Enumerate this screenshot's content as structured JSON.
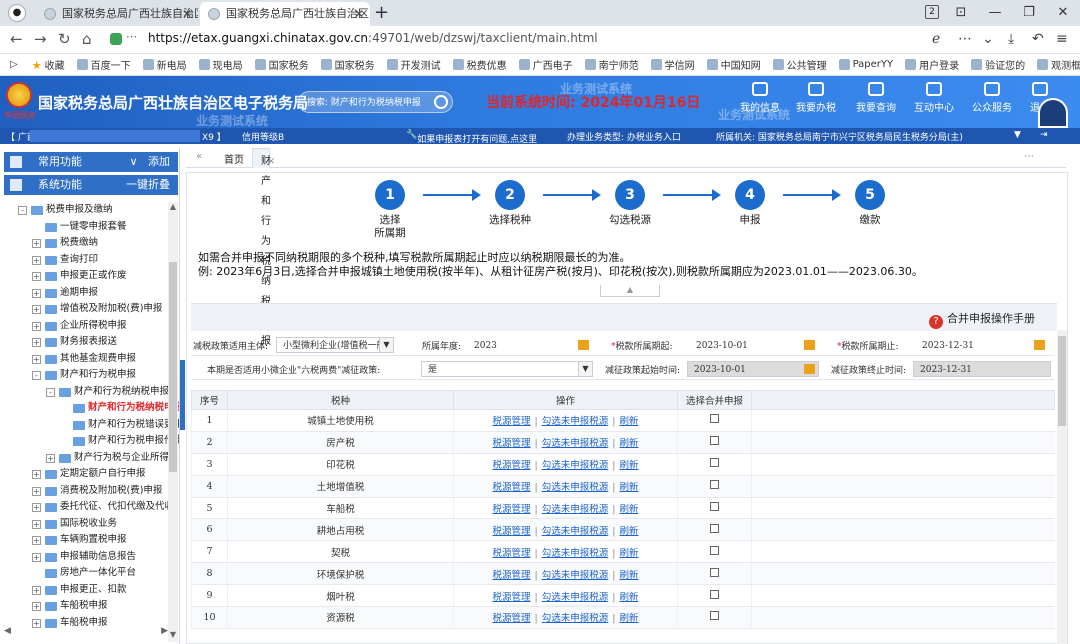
{
  "browser": {
    "tabs": [
      {
        "title": "国家税务总局广西壮族自治区",
        "active": false
      },
      {
        "title": "国家税务总局广西壮族自治区",
        "active": true
      }
    ],
    "tab_count": "2",
    "url_host": "https://etax.guangxi.chinatax.gov.cn",
    "url_path": ":49701/web/dzswj/taxclient/main.html",
    "bookmarks": [
      "收藏",
      "百度一下",
      "新电局",
      "现电局",
      "国家税务",
      "国家税务",
      "开发测试",
      "税费优惠",
      "广西电子",
      "南宁师范",
      "学信网",
      "中国知网",
      "公共管理",
      "PaperYY",
      "用户登录",
      "验证您的",
      "观测框"
    ]
  },
  "header": {
    "emblem_text": "中国税务",
    "site_title": "国家税务总局广西壮族自治区电子税务局",
    "watermark": "业务测试系统",
    "search_placeholder": "搜索: 财产和行为税纳税申报",
    "system_time_label": "当前系统时间: 2024年01月16日",
    "menu": [
      "我的信息",
      "我要办税",
      "我要查询",
      "互动中心",
      "公众服务",
      "退出"
    ],
    "accent": "#2f7be0",
    "date_color": "#e0262b"
  },
  "infobar": {
    "taxpayer_prefix": "【 广西",
    "taxpayer_suffix": "X9 】",
    "credit_level": "信用等级B",
    "refresh_hint": "如果申报表打开有问题,点这里",
    "business_type": "办理业务类型:  办税业务入口",
    "authority": "所属机关:  国家税务总局南宁市兴宁区税务局民生税务分局(主)"
  },
  "sidebar": {
    "common_label": "常用功能",
    "common_action": "添加",
    "system_label": "系统功能",
    "system_action": "一键折叠",
    "tree": [
      {
        "label": "税费申报及缴纳",
        "level": 0,
        "toggle": "-"
      },
      {
        "label": "一键零申报套餐",
        "level": 1,
        "toggle": ""
      },
      {
        "label": "税费缴纳",
        "level": 1,
        "toggle": "+"
      },
      {
        "label": "查询打印",
        "level": 1,
        "toggle": "+"
      },
      {
        "label": "申报更正或作废",
        "level": 1,
        "toggle": "+"
      },
      {
        "label": "逾期申报",
        "level": 1,
        "toggle": "+"
      },
      {
        "label": "增值税及附加税(费)申报",
        "level": 1,
        "toggle": "+"
      },
      {
        "label": "企业所得税申报",
        "level": 1,
        "toggle": "+"
      },
      {
        "label": "财务报表报送",
        "level": 1,
        "toggle": "+"
      },
      {
        "label": "其他基金规费申报",
        "level": 1,
        "toggle": "+"
      },
      {
        "label": "财产和行为税申报",
        "level": 1,
        "toggle": "-"
      },
      {
        "label": "财产和行为税纳税申报",
        "level": 2,
        "toggle": "-"
      },
      {
        "label": "财产和行为税纳税申报",
        "level": 3,
        "toggle": "",
        "selected": true
      },
      {
        "label": "财产和行为税错误更正",
        "level": 3,
        "toggle": ""
      },
      {
        "label": "财产和行为税申报作废",
        "level": 3,
        "toggle": ""
      },
      {
        "label": "财产行为税与企业所得税",
        "level": 2,
        "toggle": "+"
      },
      {
        "label": "定期定额户自行申报",
        "level": 1,
        "toggle": "+"
      },
      {
        "label": "消费税及附加税(费)申报",
        "level": 1,
        "toggle": "+"
      },
      {
        "label": "委托代征、代扣代缴及代收",
        "level": 1,
        "toggle": "+"
      },
      {
        "label": "国际税收业务",
        "level": 1,
        "toggle": "+"
      },
      {
        "label": "车辆购置税申报",
        "level": 1,
        "toggle": "+"
      },
      {
        "label": "申报辅助信息报告",
        "level": 1,
        "toggle": "+"
      },
      {
        "label": "房地产一体化平台",
        "level": 1,
        "toggle": ""
      },
      {
        "label": "申报更正、扣款",
        "level": 1,
        "toggle": "+"
      },
      {
        "label": "车船税申报",
        "level": 1,
        "toggle": "+"
      },
      {
        "label": "车船税申报",
        "level": 1,
        "toggle": "+"
      }
    ]
  },
  "main": {
    "tabs": {
      "home": "首页",
      "current": "财产和行为税纳税申报"
    },
    "steps": [
      {
        "num": "1",
        "label": "选择\n所属期"
      },
      {
        "num": "2",
        "label": "选择税种"
      },
      {
        "num": "3",
        "label": "勾选税源"
      },
      {
        "num": "4",
        "label": "申报"
      },
      {
        "num": "5",
        "label": "缴款"
      }
    ],
    "note1": "如需合并申报不同纳税期限的多个税种,填写税款所属期起止时应以纳税期限最长的为准。",
    "note2": "例: 2023年6月3日,选择合并申报城镇土地使用税(按半年)、从租计征房产税(按月)、印花税(按次),则税款所属期应为2023.01.01——2023.06.30。",
    "manual_button": "合并申报操作手册",
    "form": {
      "subject_label": "减税政策适用主体:",
      "subject_value": "小型微利企业(增值税一般",
      "year_label": "所属年度:",
      "year_value": "2023",
      "start_label": "税款所属期起:",
      "start_value": "2023-10-01",
      "end_label": "税款所属期止:",
      "end_value": "2023-12-31",
      "six_label": "本期是否适用小微企业\"六税两费\"减征政策:",
      "six_value": "是",
      "relief_start_label": "减征政策起始时间:",
      "relief_start_value": "2023-10-01",
      "relief_end_label": "减征政策终止时间:",
      "relief_end_value": "2023-12-31"
    },
    "table": {
      "headers": [
        "序号",
        "税种",
        "操作",
        "选择合并申报"
      ],
      "actions": [
        "税源管理",
        "勾选未申报税源",
        "刷新"
      ],
      "rows": [
        {
          "no": "1",
          "tax": "城镇土地使用税"
        },
        {
          "no": "2",
          "tax": "房产税"
        },
        {
          "no": "3",
          "tax": "印花税"
        },
        {
          "no": "4",
          "tax": "土地增值税"
        },
        {
          "no": "5",
          "tax": "车船税"
        },
        {
          "no": "6",
          "tax": "耕地占用税"
        },
        {
          "no": "7",
          "tax": "契税"
        },
        {
          "no": "8",
          "tax": "环境保护税"
        },
        {
          "no": "9",
          "tax": "烟叶税"
        },
        {
          "no": "10",
          "tax": "资源税"
        }
      ]
    }
  }
}
